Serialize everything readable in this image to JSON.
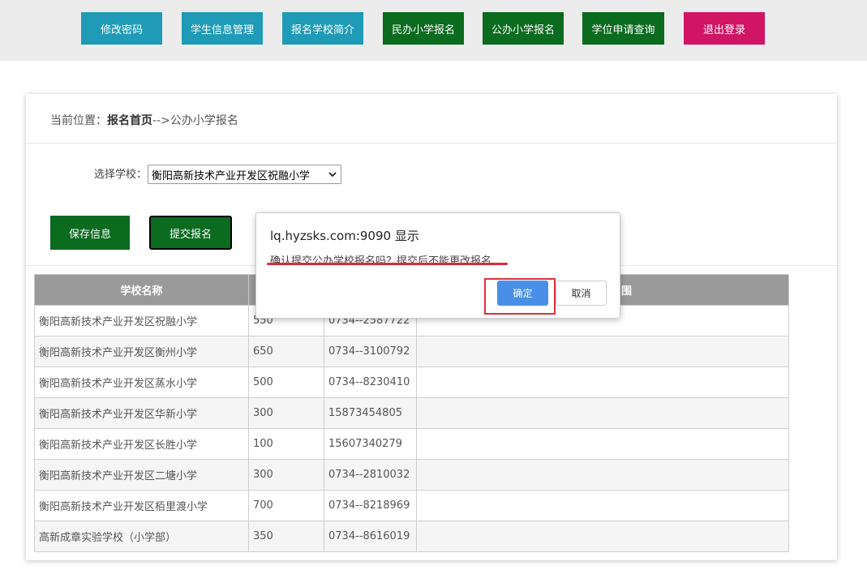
{
  "nav": {
    "items": [
      {
        "label": "修改密码"
      },
      {
        "label": "学生信息管理"
      },
      {
        "label": "报名学校简介"
      },
      {
        "label": "民办小学报名"
      },
      {
        "label": "公办小学报名"
      },
      {
        "label": "学位申请查询"
      },
      {
        "label": "退出登录"
      }
    ]
  },
  "breadcrumb": {
    "prefix": "当前位置：",
    "home": "报名首页",
    "current": "-->公办小学报名"
  },
  "school_select": {
    "label": "选择学校：",
    "selected": "衡阳高新技术产业开发区祝融小学"
  },
  "actions": {
    "save_label": "保存信息",
    "submit_label": "提交报名"
  },
  "table": {
    "header_first": "学校名称",
    "header_last_fragment": "围",
    "rows": [
      {
        "name": "衡阳高新技术产业开发区祝融小学",
        "quota": "550",
        "phone": "0734--2587722",
        "area": ""
      },
      {
        "name": "衡阳高新技术产业开发区衡州小学",
        "quota": "650",
        "phone": "0734--3100792",
        "area": ""
      },
      {
        "name": "衡阳高新技术产业开发区蒸水小学",
        "quota": "500",
        "phone": "0734--8230410",
        "area": ""
      },
      {
        "name": "衡阳高新技术产业开发区华新小学",
        "quota": "300",
        "phone": "15873454805",
        "area": ""
      },
      {
        "name": "衡阳高新技术产业开发区长胜小学",
        "quota": "100",
        "phone": "15607340279",
        "area": ""
      },
      {
        "name": "衡阳高新技术产业开发区二塘小学",
        "quota": "300",
        "phone": "0734--2810032",
        "area": ""
      },
      {
        "name": "衡阳高新技术产业开发区栢里渡小学",
        "quota": "700",
        "phone": "0734--8218969",
        "area": ""
      },
      {
        "name": "高新成章实验学校（小学部）",
        "quota": "350",
        "phone": "0734--8616019",
        "area": ""
      }
    ]
  },
  "dialog": {
    "title": "lq.hyzsks.com:9090 显示",
    "message": "确认提交公办学校报名吗？提交后不能更改报名",
    "ok_label": "确定",
    "cancel_label": "取消"
  },
  "colors": {
    "teal": "#1f9bb7",
    "green": "#0b6b1f",
    "red": "#d11463",
    "dialog_ok": "#4a8fe7",
    "annotation_red": "#e0303a"
  }
}
